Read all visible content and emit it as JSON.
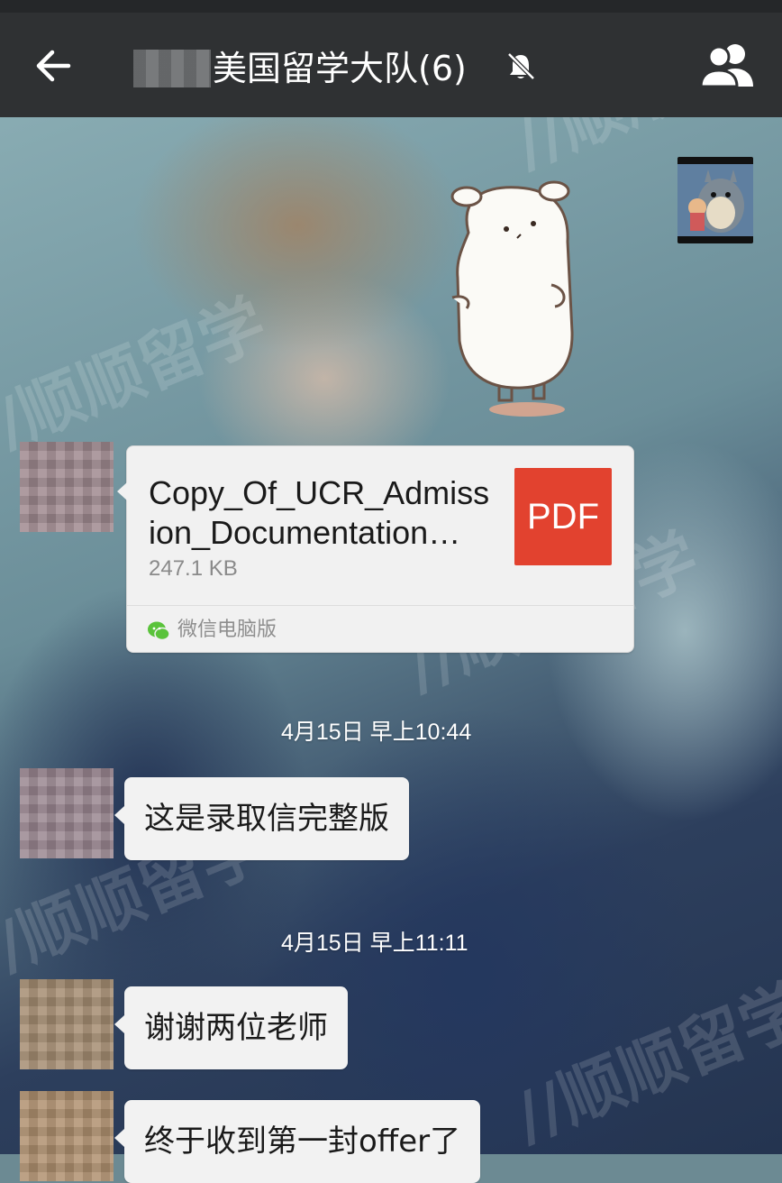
{
  "header": {
    "title": "美国留学大队(6)",
    "back_icon": "arrow-left-icon",
    "mute_icon": "bell-off-icon",
    "members_icon": "group-members-icon"
  },
  "messages": {
    "file": {
      "file_name": "Copy_Of_UCR_Admission_Documentation…",
      "size": "247.1 KB",
      "type_label": "PDF",
      "source": "微信电脑版"
    },
    "timestamp_1": "4月15日 早上10:44",
    "bubble_1": "这是录取信完整版",
    "timestamp_2": "4月15日 早上11:11",
    "bubble_2": "谢谢两位老师",
    "bubble_3": "终于收到第一封offer了"
  },
  "colors": {
    "header_bg": "#2f3133",
    "bubble_bg": "#f2f2f2",
    "pdf_red": "#e2422f",
    "wechat_green": "#5ac33b"
  }
}
